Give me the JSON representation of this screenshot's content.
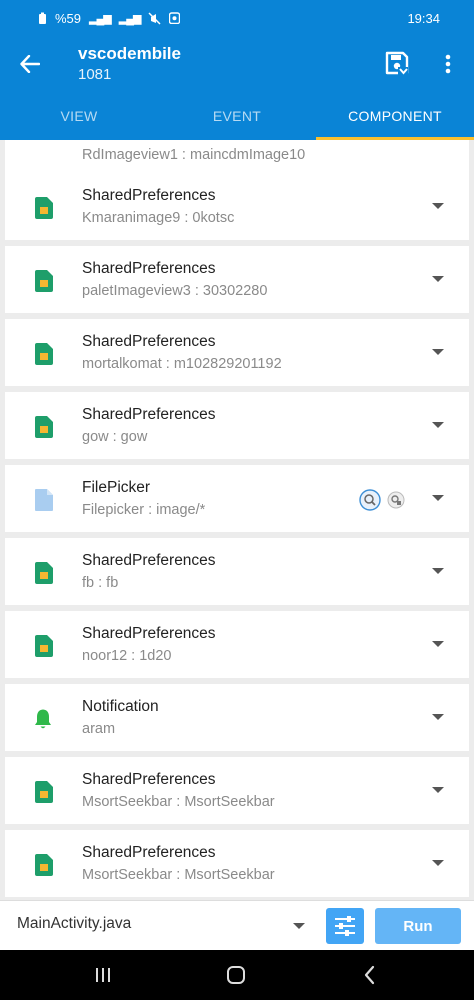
{
  "status": {
    "left": "%59",
    "time": "19:34"
  },
  "app": {
    "title": "vscodembile",
    "subtitle": "1081"
  },
  "tabs": [
    {
      "label": "VIEW"
    },
    {
      "label": "EVENT"
    },
    {
      "label": "COMPONENT"
    }
  ],
  "components": [
    {
      "name": "",
      "sub": "RdImageview1 : maincdmImage10",
      "icon": "sharedpreferences-icon"
    },
    {
      "name": "SharedPreferences",
      "sub": "Kmaranimage9 : 0kotsc",
      "icon": "sharedpreferences-icon"
    },
    {
      "name": "SharedPreferences",
      "sub": "paletImageview3 : 30302280",
      "icon": "sharedpreferences-icon"
    },
    {
      "name": "SharedPreferences",
      "sub": "mortalkomat : m102829201192",
      "icon": "sharedpreferences-icon"
    },
    {
      "name": "SharedPreferences",
      "sub": "gow : gow",
      "icon": "sharedpreferences-icon"
    },
    {
      "name": "FilePicker",
      "sub": "Filepicker : image/*",
      "icon": "file-icon"
    },
    {
      "name": "SharedPreferences",
      "sub": "fb : fb",
      "icon": "sharedpreferences-icon"
    },
    {
      "name": "SharedPreferences",
      "sub": "noor12 : 1d20",
      "icon": "sharedpreferences-icon"
    },
    {
      "name": "Notification",
      "sub": "aram",
      "icon": "bell-icon"
    },
    {
      "name": "SharedPreferences",
      "sub": "MsortSeekbar : MsortSeekbar",
      "icon": "sharedpreferences-icon"
    },
    {
      "name": "SharedPreferences",
      "sub": "MsortSeekbar : MsortSeekbar",
      "icon": "sharedpreferences-icon"
    }
  ],
  "bottom": {
    "file": "MainActivity.java",
    "run_label": "Run"
  },
  "colors": {
    "primary": "#0a84d6",
    "tab_indicator": "#fbc02d",
    "pref_icon": "#1e9e6a",
    "pref_icon_accent": "#f5b731",
    "bell": "#2fb84a",
    "file_icon": "#a9cdf0",
    "run_button": "#64b5f6"
  }
}
